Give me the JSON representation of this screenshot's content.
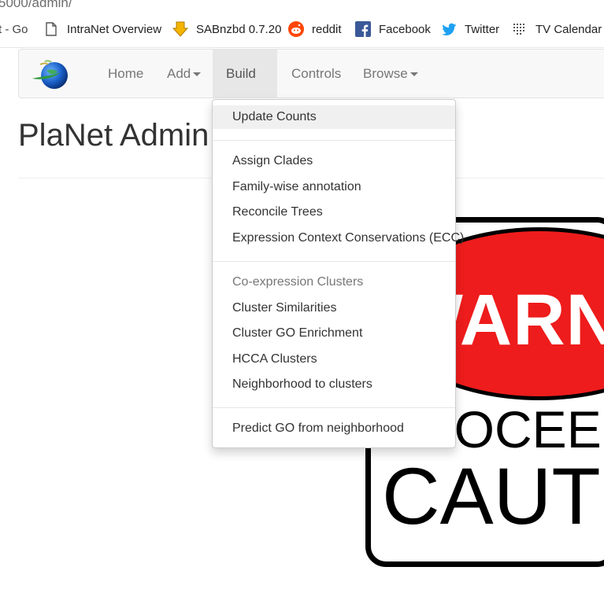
{
  "browser": {
    "url_fragment": "5000/admin/",
    "bookmarks": [
      {
        "label": "t - Go",
        "icon": "truncated-bookmark"
      },
      {
        "label": "IntraNet Overview",
        "icon": "page-icon"
      },
      {
        "label": "SABnzbd 0.7.20",
        "icon": "sabnzbd-icon"
      },
      {
        "label": "reddit",
        "icon": "reddit-icon"
      },
      {
        "label": "Facebook",
        "icon": "facebook-icon"
      },
      {
        "label": "Twitter",
        "icon": "twitter-icon"
      },
      {
        "label": "TV Calendar",
        "icon": "tv-calendar-icon"
      }
    ]
  },
  "navbar": {
    "logo": "planet-logo",
    "items": [
      {
        "label": "Home",
        "dropdown": false
      },
      {
        "label": "Add",
        "dropdown": true
      },
      {
        "label": "Build",
        "dropdown": true,
        "active": true
      },
      {
        "label": "Controls",
        "dropdown": false
      },
      {
        "label": "Browse",
        "dropdown": true
      }
    ]
  },
  "page": {
    "title": "PlaNet Admin p"
  },
  "sign": {
    "top_text": "WARN",
    "middle_text": "PROCEED",
    "bottom_text": "CAUT",
    "colors": {
      "oval": "#ee1c1c",
      "border": "#000000"
    }
  },
  "build_menu": {
    "items": [
      {
        "label": "Update Counts",
        "type": "item",
        "hover": true
      },
      {
        "type": "divider"
      },
      {
        "label": "Assign Clades",
        "type": "item"
      },
      {
        "label": "Family-wise annotation",
        "type": "item"
      },
      {
        "label": "Reconcile Trees",
        "type": "item"
      },
      {
        "label": "Expression Context Conservations (ECC)",
        "type": "item"
      },
      {
        "type": "divider"
      },
      {
        "label": "Co-expression Clusters",
        "type": "header"
      },
      {
        "label": "Cluster Similarities",
        "type": "item"
      },
      {
        "label": "Cluster GO Enrichment",
        "type": "item"
      },
      {
        "label": "HCCA Clusters",
        "type": "item"
      },
      {
        "label": "Neighborhood to clusters",
        "type": "item"
      },
      {
        "type": "divider"
      },
      {
        "label": "Predict GO from neighborhood",
        "type": "item"
      }
    ]
  }
}
